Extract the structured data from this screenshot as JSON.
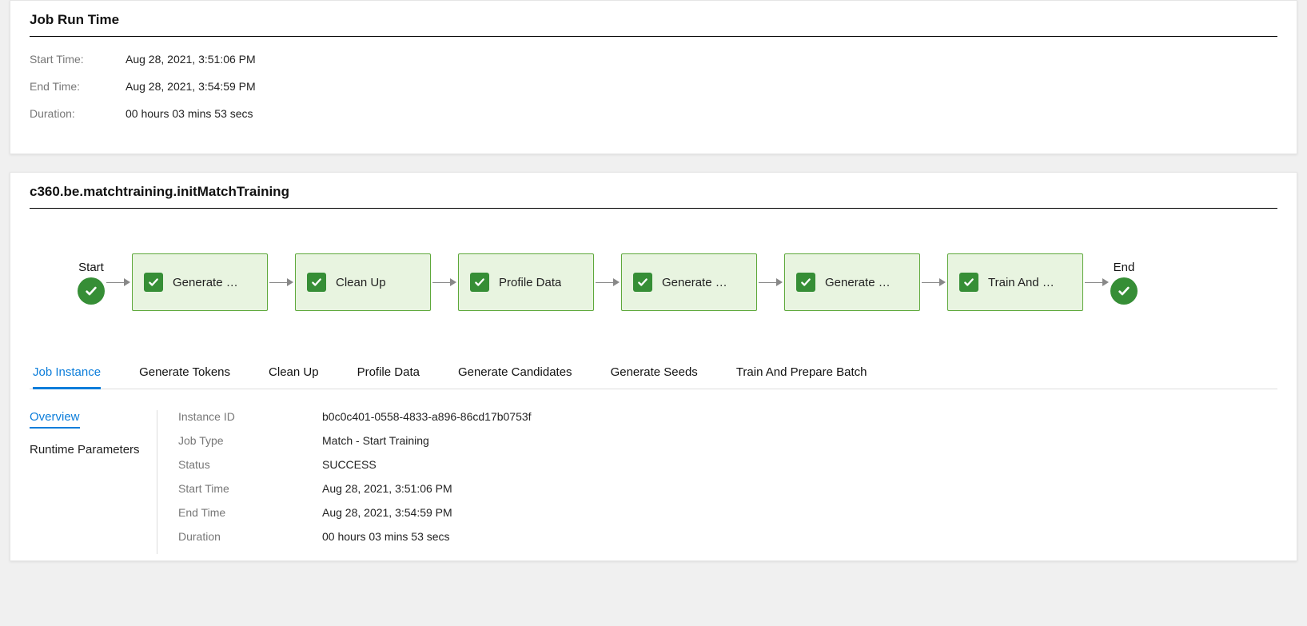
{
  "runtime": {
    "title": "Job Run Time",
    "start_label": "Start Time:",
    "start_value": "Aug 28, 2021, 3:51:06 PM",
    "end_label": "End Time:",
    "end_value": "Aug 28, 2021, 3:54:59 PM",
    "duration_label": "Duration:",
    "duration_value": "00 hours 03 mins 53 secs"
  },
  "job": {
    "title": "c360.be.matchtraining.initMatchTraining",
    "flow": {
      "start_label": "Start",
      "end_label": "End",
      "steps": [
        {
          "label": "Generate …"
        },
        {
          "label": "Clean Up"
        },
        {
          "label": "Profile Data"
        },
        {
          "label": "Generate …"
        },
        {
          "label": "Generate …"
        },
        {
          "label": "Train And …"
        }
      ]
    }
  },
  "tabs": [
    {
      "label": "Job Instance",
      "active": true
    },
    {
      "label": "Generate Tokens"
    },
    {
      "label": "Clean Up"
    },
    {
      "label": "Profile Data"
    },
    {
      "label": "Generate Candidates"
    },
    {
      "label": "Generate Seeds"
    },
    {
      "label": "Train And Prepare Batch"
    }
  ],
  "side_tabs": [
    {
      "label": "Overview",
      "active": true
    },
    {
      "label": "Runtime Parameters"
    }
  ],
  "overview": {
    "rows": [
      {
        "label": "Instance ID",
        "value": "b0c0c401-0558-4833-a896-86cd17b0753f"
      },
      {
        "label": "Job Type",
        "value": "Match - Start Training"
      },
      {
        "label": "Status",
        "value": "SUCCESS"
      },
      {
        "label": "Start Time",
        "value": "Aug 28, 2021, 3:51:06 PM"
      },
      {
        "label": "End Time",
        "value": "Aug 28, 2021, 3:54:59 PM"
      },
      {
        "label": "Duration",
        "value": "00 hours 03 mins 53 secs"
      }
    ]
  }
}
